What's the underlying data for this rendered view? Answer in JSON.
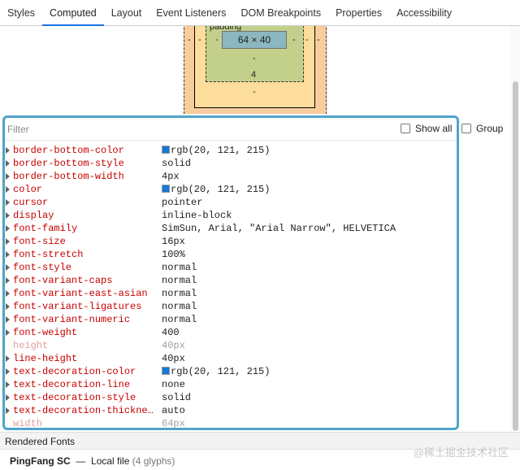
{
  "tabs": [
    "Styles",
    "Computed",
    "Layout",
    "Event Listeners",
    "DOM Breakpoints",
    "Properties",
    "Accessibility"
  ],
  "active_tab": "Computed",
  "box_model": {
    "content_size": "64 × 40",
    "padding_label": "padding",
    "margin_left": "-",
    "margin_right": "-",
    "border_left": "-",
    "border_right": "-",
    "padding_left": "-",
    "padding_right": "-",
    "padding_bottom": "-",
    "border_bottom": "4",
    "margin_bottom": "-"
  },
  "filter": {
    "placeholder": "Filter",
    "show_all_label": "Show all",
    "group_label": "Group"
  },
  "properties": [
    {
      "name": "border-bottom-color",
      "value": "rgb(20, 121, 215)",
      "swatch": "#1479d7",
      "inherited": false
    },
    {
      "name": "border-bottom-style",
      "value": "solid",
      "inherited": false
    },
    {
      "name": "border-bottom-width",
      "value": "4px",
      "inherited": false
    },
    {
      "name": "color",
      "value": "rgb(20, 121, 215)",
      "swatch": "#1479d7",
      "inherited": false
    },
    {
      "name": "cursor",
      "value": "pointer",
      "inherited": false
    },
    {
      "name": "display",
      "value": "inline-block",
      "inherited": false
    },
    {
      "name": "font-family",
      "value": "SimSun, Arial, \"Arial Narrow\", HELVETICA",
      "inherited": false
    },
    {
      "name": "font-size",
      "value": "16px",
      "inherited": false
    },
    {
      "name": "font-stretch",
      "value": "100%",
      "inherited": false
    },
    {
      "name": "font-style",
      "value": "normal",
      "inherited": false
    },
    {
      "name": "font-variant-caps",
      "value": "normal",
      "inherited": false
    },
    {
      "name": "font-variant-east-asian",
      "value": "normal",
      "inherited": false
    },
    {
      "name": "font-variant-ligatures",
      "value": "normal",
      "inherited": false
    },
    {
      "name": "font-variant-numeric",
      "value": "normal",
      "inherited": false
    },
    {
      "name": "font-weight",
      "value": "400",
      "inherited": false
    },
    {
      "name": "height",
      "value": "40px",
      "inherited": true
    },
    {
      "name": "line-height",
      "value": "40px",
      "inherited": false
    },
    {
      "name": "text-decoration-color",
      "value": "rgb(20, 121, 215)",
      "swatch": "#1479d7",
      "inherited": false
    },
    {
      "name": "text-decoration-line",
      "value": "none",
      "inherited": false
    },
    {
      "name": "text-decoration-style",
      "value": "solid",
      "inherited": false
    },
    {
      "name": "text-decoration-thickne…",
      "value": "auto",
      "inherited": false
    },
    {
      "name": "width",
      "value": "64px",
      "inherited": true
    }
  ],
  "rendered_fonts": {
    "header": "Rendered Fonts",
    "font_name": "PingFang SC",
    "dash": "—",
    "source": "Local file",
    "glyphs": "(4 glyphs)"
  },
  "watermark": "@稀土掘金技术社区",
  "colors": {
    "accent": "#1a73e8",
    "highlight_border": "#4fa4c9"
  }
}
